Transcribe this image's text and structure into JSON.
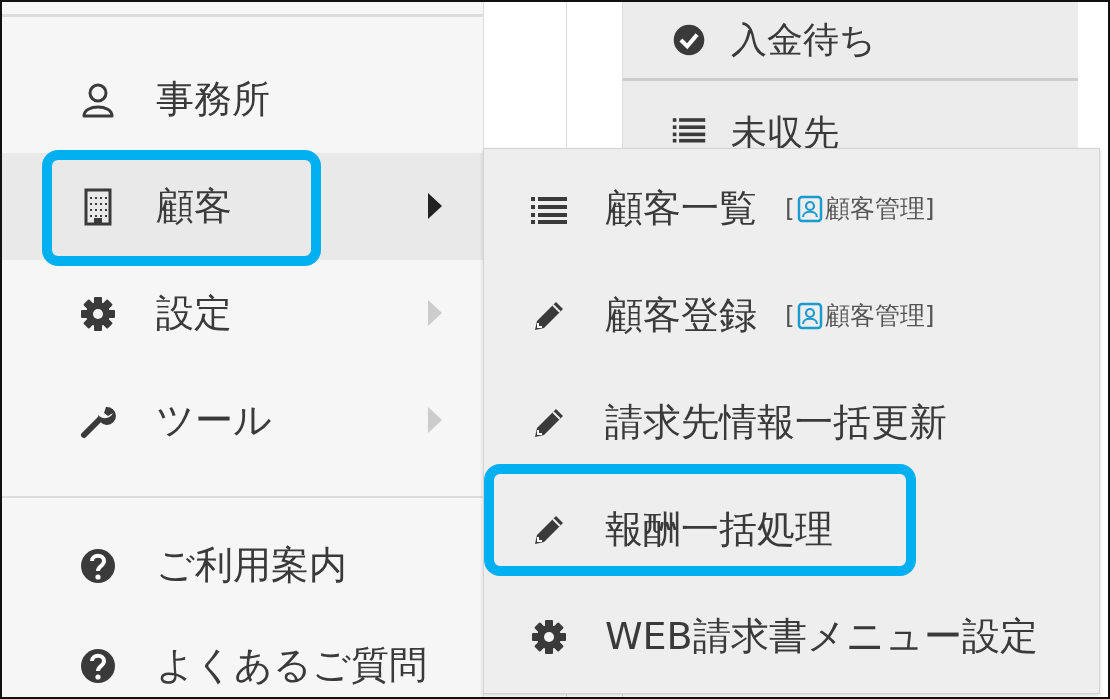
{
  "sidebar": {
    "items": [
      {
        "kind": "user",
        "label": "事務所",
        "submenu": false,
        "expanded": false,
        "highlighted": false
      },
      {
        "kind": "building",
        "label": "顧客",
        "submenu": true,
        "expanded": true,
        "highlighted": true
      },
      {
        "kind": "gear",
        "label": "設定",
        "submenu": true,
        "expanded": false,
        "highlighted": false
      },
      {
        "kind": "wrench",
        "label": "ツール",
        "submenu": true,
        "expanded": false,
        "highlighted": false
      }
    ],
    "help_items": [
      {
        "kind": "question",
        "label": "ご利用案内"
      },
      {
        "kind": "question",
        "label": "よくあるご質問"
      }
    ]
  },
  "dropdown": {
    "items": [
      {
        "kind": "check",
        "label": "入金待ち"
      },
      {
        "kind": "list",
        "label": "未収先"
      }
    ]
  },
  "submenu": {
    "items": [
      {
        "kind": "list",
        "label": "顧客一覧",
        "tag": {
          "open": "[",
          "label": "顧客管理",
          "close": "]"
        },
        "highlighted": false
      },
      {
        "kind": "pencil",
        "label": "顧客登録",
        "tag": {
          "open": "[",
          "label": "顧客管理",
          "close": "]"
        },
        "highlighted": false
      },
      {
        "kind": "pencil",
        "label": "請求先情報一括更新",
        "highlighted": false
      },
      {
        "kind": "pencil",
        "label": "報酬一括処理",
        "highlighted": true
      },
      {
        "kind": "gear",
        "label": "WEB請求書メニュー設定",
        "highlighted": false
      }
    ]
  }
}
